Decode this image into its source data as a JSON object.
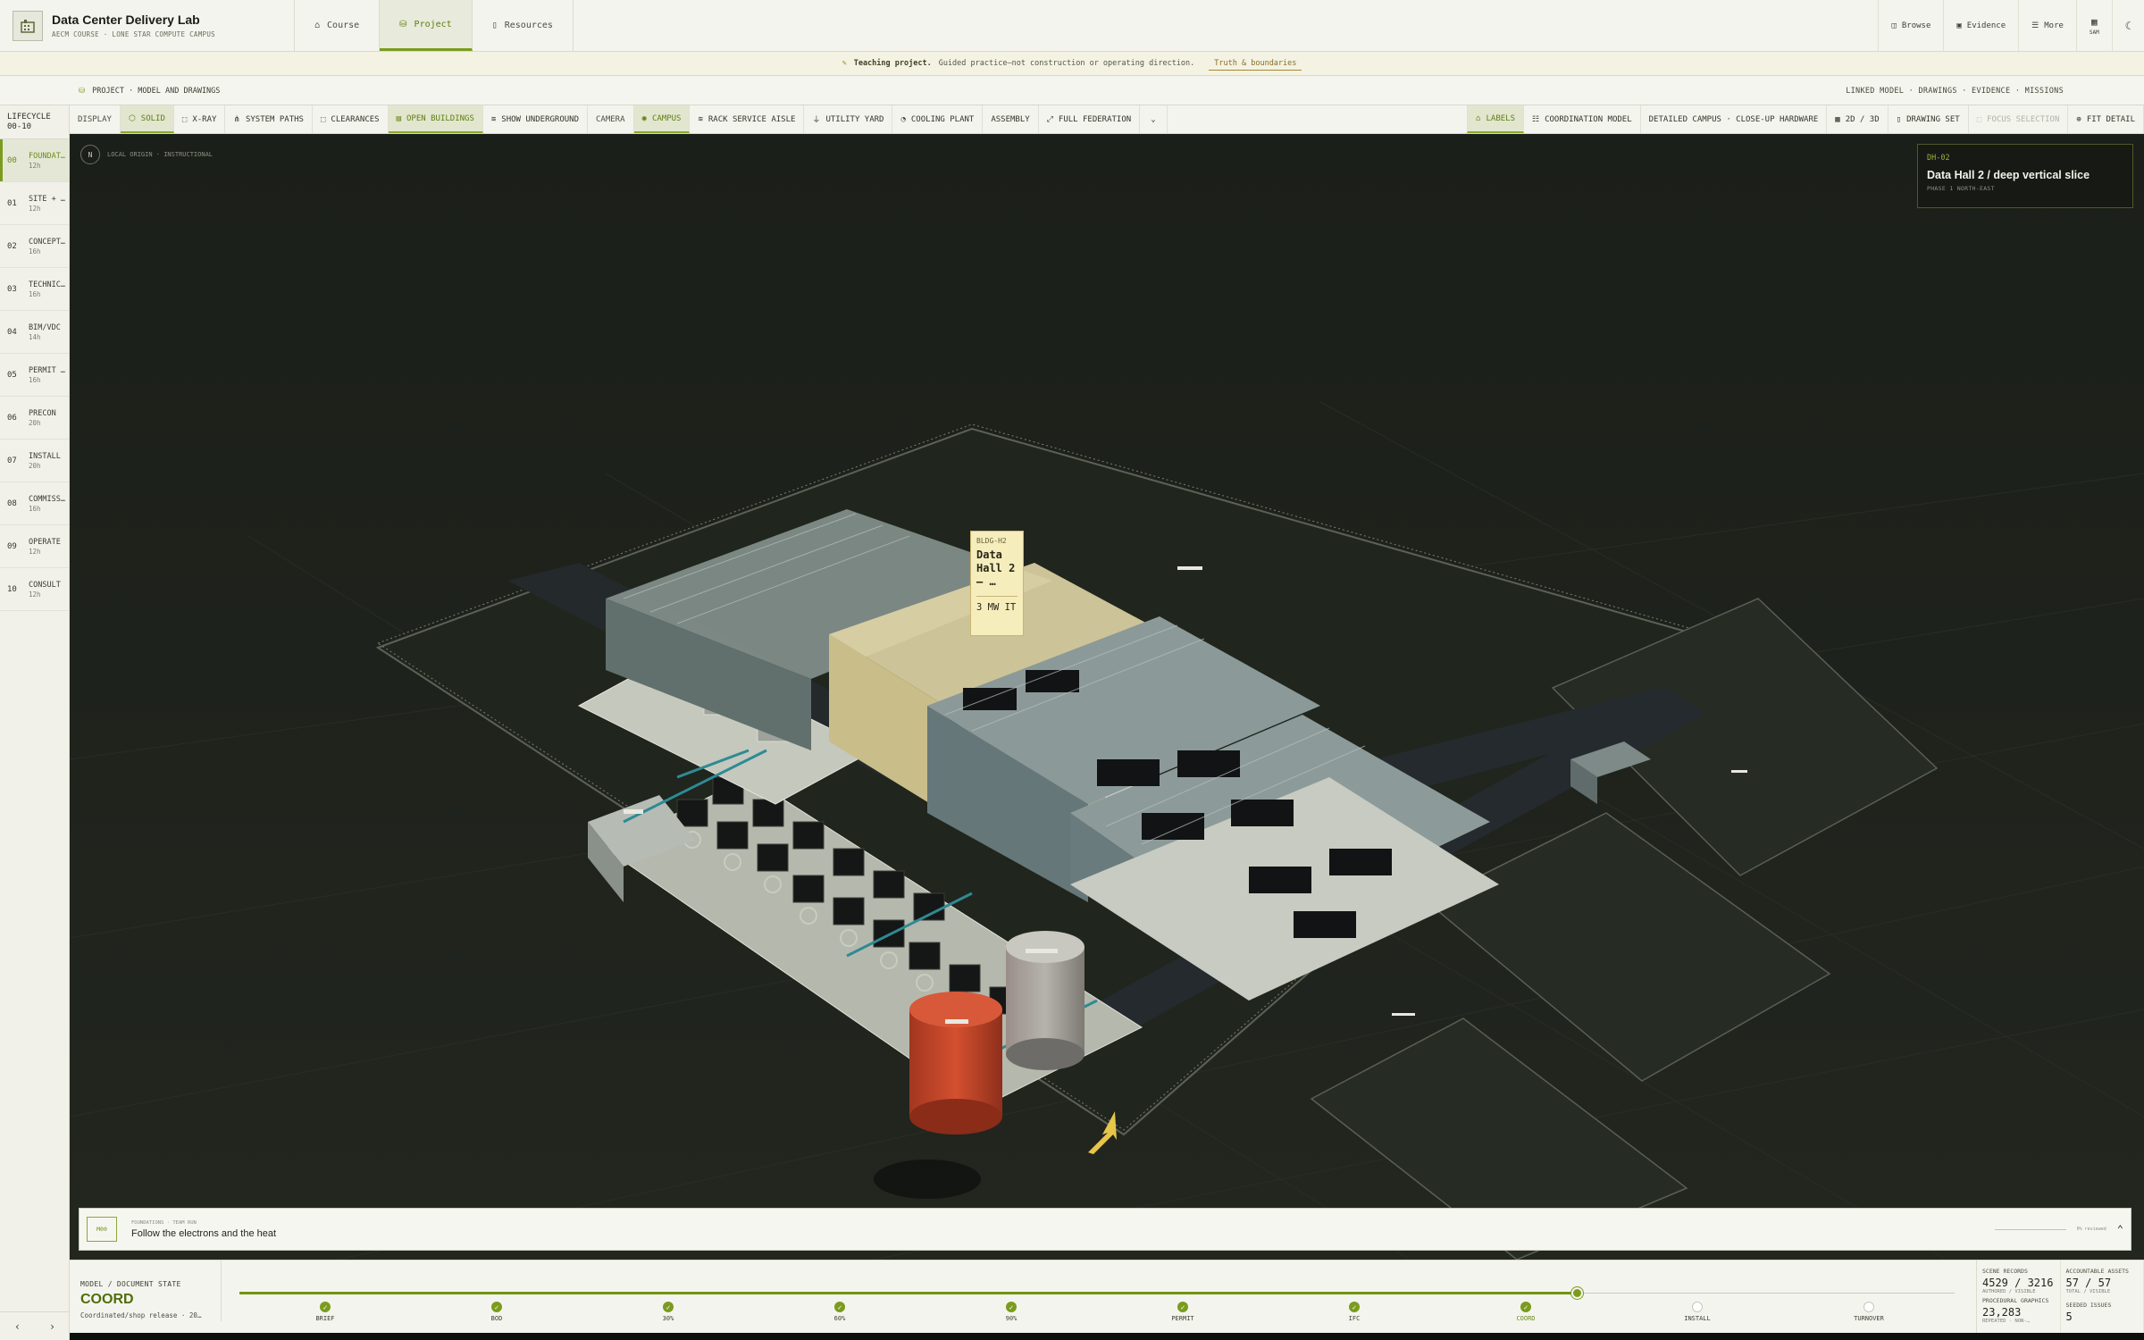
{
  "app": {
    "title": "Data Center Delivery Lab",
    "subtitle": "AECM COURSE · LONE STAR COMPUTE CAMPUS"
  },
  "nav": {
    "tabs": [
      {
        "label": "Course",
        "icon": "mortarboard-icon",
        "active": false
      },
      {
        "label": "Project",
        "icon": "cubes-icon",
        "active": true
      },
      {
        "label": "Resources",
        "icon": "book-icon",
        "active": false
      }
    ],
    "right": [
      {
        "label": "Browse",
        "icon": "panel-icon"
      },
      {
        "label": "Evidence",
        "icon": "document-icon"
      },
      {
        "label": "More",
        "icon": "menu-icon"
      },
      {
        "label": "SAM",
        "icon": "grid-icon"
      }
    ]
  },
  "banner": {
    "strong": "Teaching project.",
    "text": "Guided practice—not construction or operating direction.",
    "link": "Truth & boundaries"
  },
  "breadcrumb": "PROJECT · MODEL AND DRAWINGS",
  "linked": "LINKED MODEL · DRAWINGS · EVIDENCE · MISSIONS",
  "lifecycle": {
    "heading": "LIFECYCLE",
    "range": "00-10",
    "items": [
      {
        "num": "00",
        "label": "FOUNDAT…",
        "dur": "12h",
        "active": true
      },
      {
        "num": "01",
        "label": "SITE + …",
        "dur": "12h",
        "active": false
      },
      {
        "num": "02",
        "label": "CONCEPT…",
        "dur": "16h",
        "active": false
      },
      {
        "num": "03",
        "label": "TECHNIC…",
        "dur": "16h",
        "active": false
      },
      {
        "num": "04",
        "label": "BIM/VDC",
        "dur": "14h",
        "active": false
      },
      {
        "num": "05",
        "label": "PERMIT …",
        "dur": "16h",
        "active": false
      },
      {
        "num": "06",
        "label": "PRECON",
        "dur": "20h",
        "active": false
      },
      {
        "num": "07",
        "label": "INSTALL",
        "dur": "20h",
        "active": false
      },
      {
        "num": "08",
        "label": "COMMISS…",
        "dur": "16h",
        "active": false
      },
      {
        "num": "09",
        "label": "OPERATE",
        "dur": "12h",
        "active": false
      },
      {
        "num": "10",
        "label": "CONSULT",
        "dur": "12h",
        "active": false
      }
    ]
  },
  "toolbar": {
    "display_label": "DISPLAY",
    "solid": "SOLID",
    "xray": "X-RAY",
    "system_paths": "SYSTEM PATHS",
    "clearances": "CLEARANCES",
    "open_buildings": "OPEN BUILDINGS",
    "show_underground": "SHOW UNDERGROUND",
    "camera_label": "CAMERA",
    "campus": "CAMPUS",
    "rack_aisle": "RACK SERVICE AISLE",
    "utility_yard": "UTILITY YARD",
    "cooling_plant": "COOLING PLANT",
    "assembly": "ASSEMBLY",
    "full_federation": "FULL FEDERATION",
    "labels": "LABELS",
    "coordination_model": "COORDINATION MODEL",
    "detailed_campus": "DETAILED CAMPUS · CLOSE-UP HARDWARE",
    "view_2d3d": "2D / 3D",
    "drawing_set": "DRAWING SET",
    "focus_selection": "FOCUS SELECTION",
    "fit_detail": "FIT DETAIL"
  },
  "viewport": {
    "origin_label": "LOCAL ORIGIN · INSTRUCTIONAL",
    "focus": {
      "code": "DH-02",
      "title": "Data Hall 2 / deep vertical slice",
      "phase": "PHASE 1 NORTH-EAST"
    },
    "building_label": {
      "code": "BLDG-H2",
      "name": "Data Hall 2 – …",
      "capacity": "3 MW IT"
    }
  },
  "mission": {
    "badge": "M00",
    "pretitle": "FOUNDATIONS · TEAM RUN",
    "title": "Follow the electrons and the heat",
    "status": "0% reviewed"
  },
  "state": {
    "label": "MODEL / DOCUMENT STATE",
    "value": "COORD",
    "sub": "Coordinated/shop release · 20…",
    "progress": 0.78,
    "gates": [
      {
        "label": "BRIEF",
        "done": true
      },
      {
        "label": "BOD",
        "done": true
      },
      {
        "label": "30%",
        "done": true
      },
      {
        "label": "60%",
        "done": true
      },
      {
        "label": "90%",
        "done": true
      },
      {
        "label": "PERMIT",
        "done": true
      },
      {
        "label": "IFC",
        "done": true
      },
      {
        "label": "COORD",
        "done": true,
        "current": true
      },
      {
        "label": "INSTALL",
        "done": false
      },
      {
        "label": "TURNOVER",
        "done": false
      }
    ]
  },
  "stats": {
    "scene_records_label": "SCENE RECORDS",
    "scene_records": "4529 / 3216",
    "scene_records_sub": "AUTHORED / VISIBLE",
    "procedural_label": "PROCEDURAL GRAPHICS",
    "procedural": "23,283",
    "procedural_sub": "REPEATED · NON-…",
    "assets_label": "ACCOUNTABLE ASSETS",
    "assets": "57 / 57",
    "assets_sub": "TOTAL / VISIBLE",
    "issues_label": "SEEDED ISSUES",
    "issues": "5"
  },
  "colors": {
    "accent": "#7a9c1e",
    "viewport_bg": "#1d211b",
    "tank_red": "#c1442a",
    "label_yellow": "#f6edbd"
  }
}
